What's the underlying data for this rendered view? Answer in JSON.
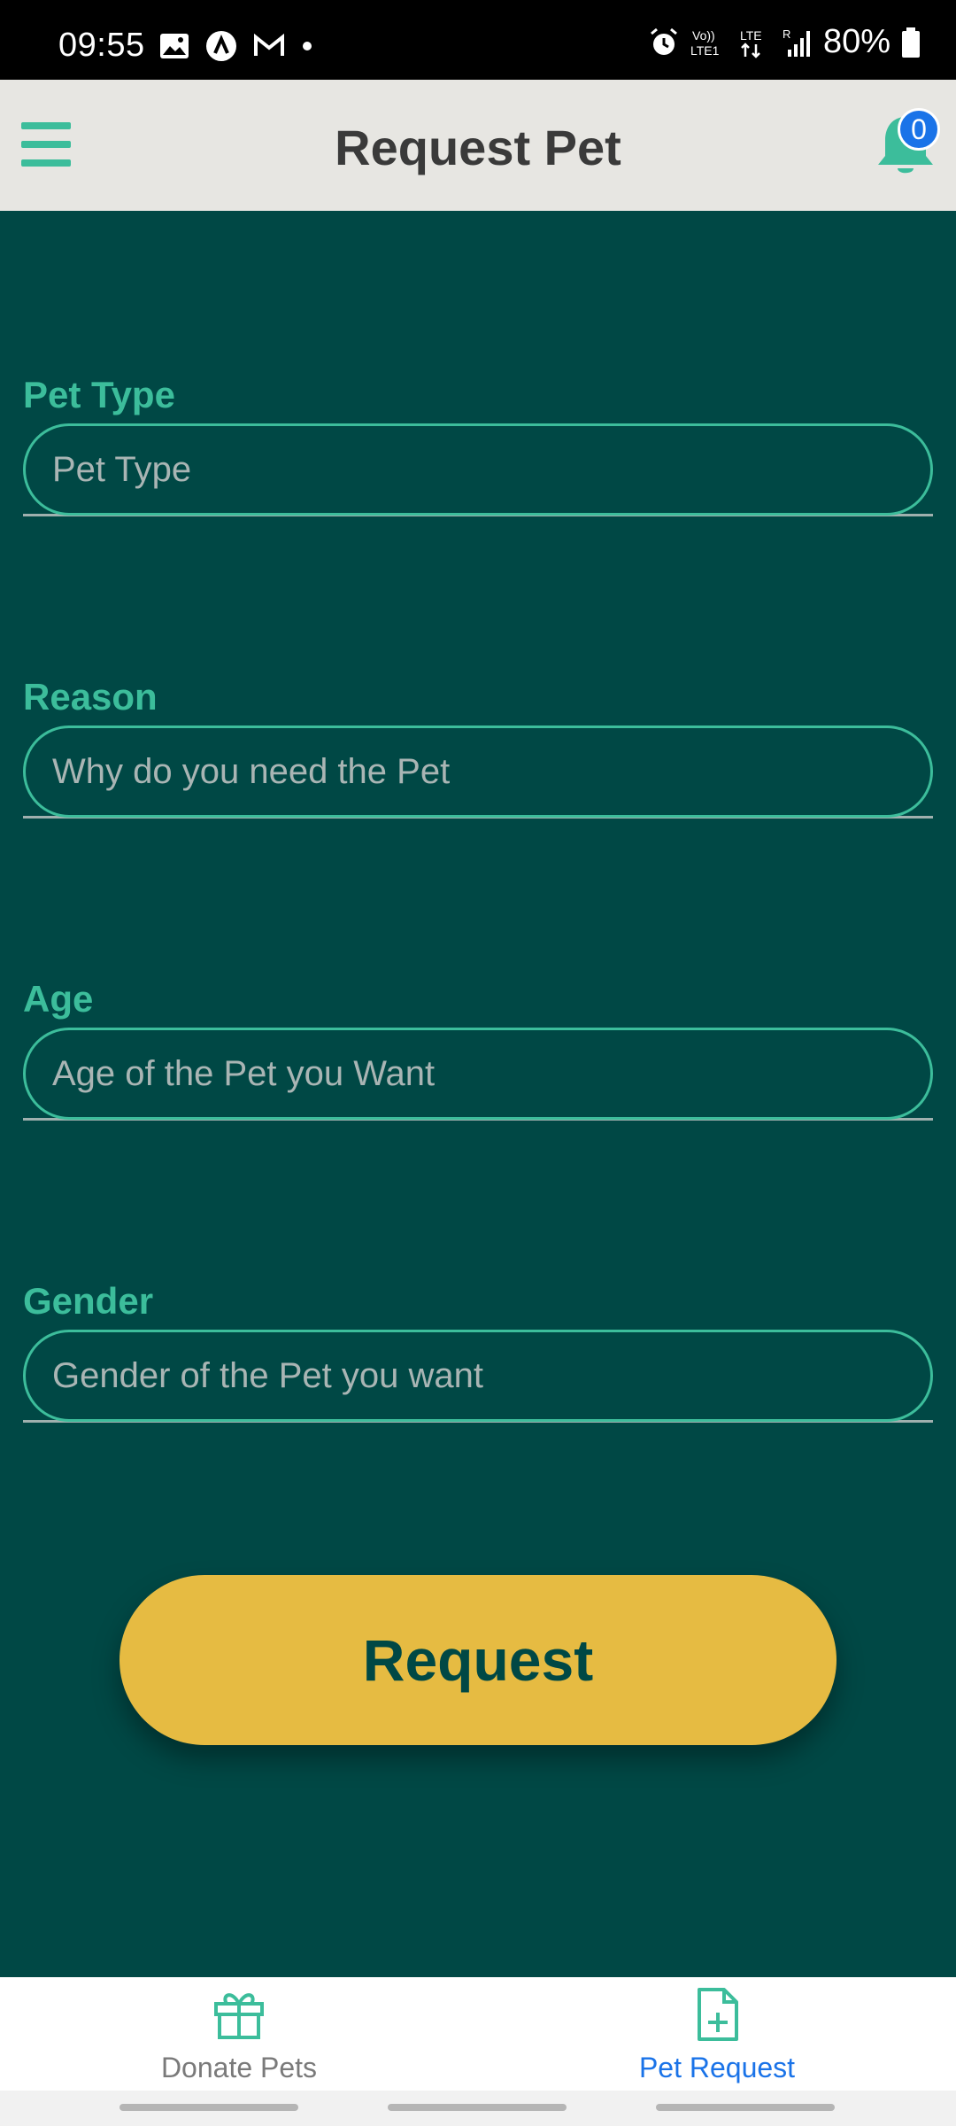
{
  "status_bar": {
    "time": "09:55",
    "battery": "80%",
    "left_icons": [
      "image-icon",
      "app-a-icon",
      "gmail-icon",
      "dot-icon"
    ],
    "right_icons": [
      "alarm-icon",
      "volte-icon",
      "lte-icon",
      "signal-icon",
      "battery-icon"
    ]
  },
  "header": {
    "title": "Request Pet",
    "notification_count": "0"
  },
  "form": {
    "fields": [
      {
        "label": "Pet Type",
        "placeholder": "Pet Type"
      },
      {
        "label": "Reason",
        "placeholder": "Why do you need the Pet"
      },
      {
        "label": "Age",
        "placeholder": "Age of the Pet you Want"
      },
      {
        "label": "Gender",
        "placeholder": "Gender of the Pet you want"
      }
    ],
    "submit_label": "Request"
  },
  "bottom_nav": {
    "items": [
      {
        "label": "Donate Pets",
        "icon": "gift-icon",
        "active": false
      },
      {
        "label": "Pet Request",
        "icon": "file-add-icon",
        "active": true
      }
    ]
  },
  "colors": {
    "background": "#004845",
    "accent": "#3cbd9b",
    "button": "#e6bb42",
    "header_bg": "#e7e6e2",
    "active_nav": "#1a73e8"
  }
}
